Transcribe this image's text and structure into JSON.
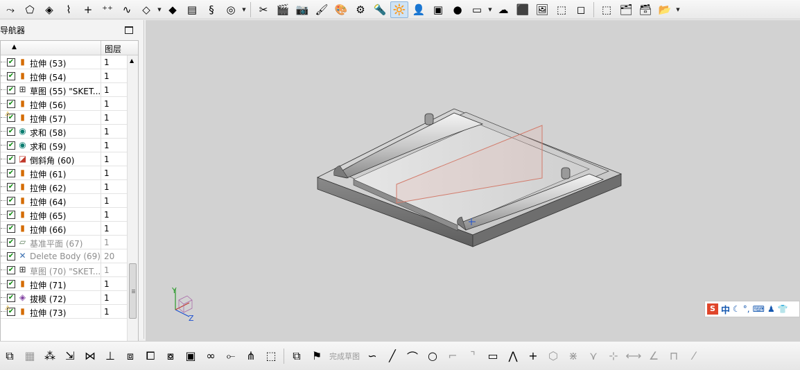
{
  "top_toolbar": {
    "icons": [
      {
        "name": "profile-icon",
        "glyph": "⤳"
      },
      {
        "name": "rectangle-sketch-icon",
        "glyph": "⬠"
      },
      {
        "name": "sketch-on-face-icon",
        "glyph": "◈"
      },
      {
        "name": "curve-offset-icon",
        "glyph": "⌇"
      },
      {
        "name": "point-icon",
        "glyph": "+"
      },
      {
        "name": "point-set-icon",
        "glyph": "⁺⁺"
      },
      {
        "name": "spline-icon",
        "glyph": "∿"
      },
      {
        "name": "datum-plane-icon",
        "glyph": "◇"
      },
      {
        "name": "datum-csys-icon",
        "glyph": "◆"
      },
      {
        "name": "cylinder-icon",
        "glyph": "▤"
      },
      {
        "name": "spring-icon",
        "glyph": "§"
      },
      {
        "name": "coil-icon",
        "glyph": "◎"
      },
      {
        "name": "tools-icon",
        "glyph": "✂"
      },
      {
        "name": "clapper-icon",
        "glyph": "🎬"
      },
      {
        "name": "camera-icon",
        "glyph": "📷"
      },
      {
        "name": "paint-icon",
        "glyph": "🖌"
      },
      {
        "name": "colors-icon",
        "glyph": "🎨"
      },
      {
        "name": "settings-gear-icon",
        "glyph": "⚙"
      },
      {
        "name": "flashlight-icon",
        "glyph": "🔦"
      },
      {
        "name": "highlight-box-icon",
        "glyph": "🔆"
      },
      {
        "name": "user-icon",
        "glyph": "👤"
      },
      {
        "name": "scene-icon",
        "glyph": "▣"
      },
      {
        "name": "spheres-icon",
        "glyph": "●"
      },
      {
        "name": "window-icon",
        "glyph": "▭"
      },
      {
        "name": "cloud-icon",
        "glyph": "☁"
      },
      {
        "name": "cube-icon",
        "glyph": "⬛"
      },
      {
        "name": "landscape-icon",
        "glyph": "🖼"
      },
      {
        "name": "wireframe-cube-icon",
        "glyph": "⬚"
      },
      {
        "name": "cube-outline-icon",
        "glyph": "◻"
      },
      {
        "name": "select-box-icon",
        "glyph": "⬚"
      },
      {
        "name": "layers-icon",
        "glyph": "🗂"
      },
      {
        "name": "layer-edit-icon",
        "glyph": "🗃"
      },
      {
        "name": "layer-settings-icon",
        "glyph": "📂"
      }
    ]
  },
  "navigator": {
    "title": "导航器",
    "col_layer": "图层",
    "rows": [
      {
        "icon": "extrude-icon",
        "glyph": "▮",
        "cls": "ic-extrude",
        "name": "拉伸 (53)",
        "layer": "1",
        "dim": false,
        "warn": false
      },
      {
        "icon": "extrude-icon",
        "glyph": "▮",
        "cls": "ic-extrude",
        "name": "拉伸 (54)",
        "layer": "1",
        "dim": false,
        "warn": false
      },
      {
        "icon": "sketch-icon",
        "glyph": "⊞",
        "cls": "ic-sketch",
        "name": "草图 (55) \"SKET...",
        "layer": "1",
        "dim": false,
        "warn": false
      },
      {
        "icon": "extrude-icon",
        "glyph": "▮",
        "cls": "ic-extrude",
        "name": "拉伸 (56)",
        "layer": "1",
        "dim": false,
        "warn": false
      },
      {
        "icon": "extrude-icon",
        "glyph": "▮",
        "cls": "ic-extrude",
        "name": "拉伸 (57)",
        "layer": "1",
        "dim": false,
        "warn": true
      },
      {
        "icon": "unite-icon",
        "glyph": "◉",
        "cls": "ic-unite",
        "name": "求和 (58)",
        "layer": "1",
        "dim": false,
        "warn": false
      },
      {
        "icon": "unite-icon",
        "glyph": "◉",
        "cls": "ic-unite",
        "name": "求和 (59)",
        "layer": "1",
        "dim": false,
        "warn": false
      },
      {
        "icon": "chamfer-icon",
        "glyph": "◪",
        "cls": "ic-chamfer",
        "name": "倒斜角 (60)",
        "layer": "1",
        "dim": false,
        "warn": false
      },
      {
        "icon": "extrude-icon",
        "glyph": "▮",
        "cls": "ic-extrude",
        "name": "拉伸 (61)",
        "layer": "1",
        "dim": false,
        "warn": false
      },
      {
        "icon": "extrude-icon",
        "glyph": "▮",
        "cls": "ic-extrude",
        "name": "拉伸 (62)",
        "layer": "1",
        "dim": false,
        "warn": false
      },
      {
        "icon": "extrude-icon",
        "glyph": "▮",
        "cls": "ic-extrude",
        "name": "拉伸 (64)",
        "layer": "1",
        "dim": false,
        "warn": false
      },
      {
        "icon": "extrude-icon",
        "glyph": "▮",
        "cls": "ic-extrude",
        "name": "拉伸 (65)",
        "layer": "1",
        "dim": false,
        "warn": false
      },
      {
        "icon": "extrude-icon",
        "glyph": "▮",
        "cls": "ic-extrude",
        "name": "拉伸 (66)",
        "layer": "1",
        "dim": false,
        "warn": false
      },
      {
        "icon": "datum-plane-icon",
        "glyph": "▱",
        "cls": "ic-plane",
        "name": "基准平面 (67)",
        "layer": "1",
        "dim": true,
        "warn": false
      },
      {
        "icon": "delete-body-icon",
        "glyph": "✕",
        "cls": "ic-delete",
        "name": "Delete Body (69)",
        "layer": "20",
        "dim": true,
        "warn": false
      },
      {
        "icon": "sketch-icon",
        "glyph": "⊞",
        "cls": "ic-sketch",
        "name": "草图 (70) \"SKET...",
        "layer": "1",
        "dim": true,
        "warn": false
      },
      {
        "icon": "extrude-icon",
        "glyph": "▮",
        "cls": "ic-extrude",
        "name": "拉伸 (71)",
        "layer": "1",
        "dim": false,
        "warn": false
      },
      {
        "icon": "draft-icon",
        "glyph": "◈",
        "cls": "ic-draft",
        "name": "拔模 (72)",
        "layer": "1",
        "dim": false,
        "warn": false
      },
      {
        "icon": "extrude-icon",
        "glyph": "▮",
        "cls": "ic-extrude",
        "name": "拉伸 (73)",
        "layer": "1",
        "dim": false,
        "warn": true
      }
    ]
  },
  "viewport": {
    "axis_y": "Y",
    "axis_z": "Z"
  },
  "ime": {
    "logo": "S",
    "lang": "中",
    "icons": [
      {
        "name": "moon-icon",
        "glyph": "☾"
      },
      {
        "name": "punctuation-icon",
        "glyph": "°,"
      },
      {
        "name": "keyboard-icon",
        "glyph": "⌨"
      },
      {
        "name": "person-icon",
        "glyph": "♟"
      },
      {
        "name": "shirt-icon",
        "glyph": "👕"
      }
    ]
  },
  "bottom_toolbar": {
    "finish_sketch_label": "完成草图",
    "icons_left": [
      {
        "name": "edit-icon",
        "glyph": "⧉",
        "faded": false
      },
      {
        "name": "sheet-icon",
        "glyph": "▦",
        "faded": true
      },
      {
        "name": "add-part-icon",
        "glyph": "⁂",
        "faded": false
      },
      {
        "name": "move-icon",
        "glyph": "⇲",
        "faded": false
      },
      {
        "name": "mirror-icon",
        "glyph": "⋈",
        "faded": false
      },
      {
        "name": "constraint-icon",
        "glyph": "⊥",
        "faded": false
      },
      {
        "name": "wave-link-icon",
        "glyph": "⧈",
        "faded": false
      },
      {
        "name": "assembly-icon",
        "glyph": "⧠",
        "faded": false
      },
      {
        "name": "replace-icon",
        "glyph": "⧇",
        "faded": false
      },
      {
        "name": "package-icon",
        "glyph": "▣",
        "faded": false
      },
      {
        "name": "chain-icon",
        "glyph": "∞",
        "faded": false
      },
      {
        "name": "link-edit-icon",
        "glyph": "⟜",
        "faded": false
      },
      {
        "name": "route-icon",
        "glyph": "⋔",
        "faded": false
      },
      {
        "name": "blocks-icon",
        "glyph": "⬚",
        "faded": false
      }
    ],
    "icons_sketch": [
      {
        "name": "sketch-task-icon",
        "glyph": "⧉",
        "faded": false
      },
      {
        "name": "finish-flag-icon",
        "glyph": "⚑",
        "faded": false
      }
    ],
    "icons_right": [
      {
        "name": "profile-arc-icon",
        "glyph": "∽",
        "faded": false
      },
      {
        "name": "line-icon",
        "glyph": "╱",
        "faded": false
      },
      {
        "name": "arc-icon",
        "glyph": "⌒",
        "faded": false
      },
      {
        "name": "circle-icon",
        "glyph": "○",
        "faded": false
      },
      {
        "name": "fillet-icon",
        "glyph": "⌐",
        "faded": true
      },
      {
        "name": "chamfer-line-icon",
        "glyph": "⌝",
        "faded": true
      },
      {
        "name": "rectangle-icon",
        "glyph": "▭",
        "faded": false
      },
      {
        "name": "polyline-icon",
        "glyph": "⋀",
        "faded": false
      },
      {
        "name": "point-plus-icon",
        "glyph": "+",
        "faded": false
      },
      {
        "name": "offset-curve-icon",
        "glyph": "⬡",
        "faded": true
      },
      {
        "name": "trim-icon",
        "glyph": "⋇",
        "faded": true
      },
      {
        "name": "extend-icon",
        "glyph": "⋎",
        "faded": true
      },
      {
        "name": "corner-icon",
        "glyph": "⊹",
        "faded": true
      },
      {
        "name": "quick-dim-icon",
        "glyph": "⟷",
        "faded": true
      },
      {
        "name": "dim-angle-icon",
        "glyph": "∠",
        "faded": true
      },
      {
        "name": "dim-frame-icon",
        "glyph": "⊓",
        "faded": true
      },
      {
        "name": "dim-slash-icon",
        "glyph": "⁄",
        "faded": true
      }
    ]
  }
}
